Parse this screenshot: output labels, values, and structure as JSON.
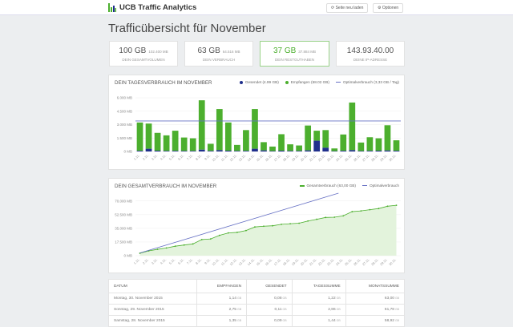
{
  "header": {
    "app_title": "UCB Traffic Analytics",
    "reload_label": "Seite neu laden",
    "options_label": "Optionen",
    "reload_icon": "refresh-icon",
    "options_icon": "gear-icon"
  },
  "page_title": "Trafficübersicht für November",
  "cards": [
    {
      "value": "100 GB",
      "sub": "102.400 MB",
      "label": "Dein Gesamtvolumen"
    },
    {
      "value": "63 GB",
      "sub": "64.516 MB",
      "label": "Dein Verbrauch"
    },
    {
      "value": "37 GB",
      "sub": "37.884 MB",
      "label": "Dein Restguthaben",
      "highlight": true
    },
    {
      "value": "143.93.40.00",
      "sub": "",
      "label": "Deine IP-Adresse"
    }
  ],
  "colors": {
    "sent": "#1f2f8c",
    "received": "#4caf2e",
    "optimal": "#6670c4",
    "highlight": "#4caf2e"
  },
  "chart_data": [
    {
      "type": "bar",
      "stacked": true,
      "title": "Dein Tagesverbrauch im November",
      "categories": [
        "1.11.",
        "2.11.",
        "3.11.",
        "4.11.",
        "5.11.",
        "6.11.",
        "7.11.",
        "8.11.",
        "9.11.",
        "10.11.",
        "11.11.",
        "12.11.",
        "13.11.",
        "14.11.",
        "15.11.",
        "16.11.",
        "17.11.",
        "18.11.",
        "19.11.",
        "20.11.",
        "21.11.",
        "22.11.",
        "23.11.",
        "24.11.",
        "25.11.",
        "26.11.",
        "27.11.",
        "28.11.",
        "29.11.",
        "30.11."
      ],
      "series": [
        {
          "name": "Gesendet (4.99 GB)",
          "values": [
            80,
            300,
            90,
            60,
            70,
            60,
            60,
            200,
            60,
            150,
            90,
            60,
            70,
            300,
            120,
            50,
            90,
            60,
            60,
            120,
            1200,
            420,
            40,
            80,
            150,
            50,
            70,
            90,
            110,
            80
          ]
        },
        {
          "name": "Empfangen (58.02 GB)",
          "values": [
            3160,
            2820,
            1990,
            1740,
            2250,
            1500,
            1410,
            5520,
            800,
            4590,
            3150,
            670,
            2320,
            4440,
            920,
            500,
            1840,
            740,
            610,
            2780,
            1120,
            1970,
            300,
            1820,
            5320,
            950,
            1520,
            1380,
            2820,
            1170
          ]
        }
      ],
      "reference_line": {
        "name": "Optimalverbrauch (3,33 GB / Tag)",
        "value": 3410
      },
      "yticks": [
        "0 MB",
        "1.500 MB",
        "3.000 MB",
        "4.500 MB",
        "6.000 MB"
      ],
      "ytick_values": [
        0,
        1500,
        3000,
        4500,
        6000
      ],
      "ylim": [
        0,
        6000
      ],
      "legend": "top-right",
      "grid": true
    },
    {
      "type": "area",
      "title": "Dein Gesamtverbrauch im November",
      "categories": [
        "1.11.",
        "2.11.",
        "3.11.",
        "4.11.",
        "5.11.",
        "6.11.",
        "7.11.",
        "8.11.",
        "9.11.",
        "10.11.",
        "11.11.",
        "12.11.",
        "13.11.",
        "14.11.",
        "15.11.",
        "16.11.",
        "17.11.",
        "18.11.",
        "19.11.",
        "20.11.",
        "21.11.",
        "22.11.",
        "23.11.",
        "24.11.",
        "25.11.",
        "26.11.",
        "27.11.",
        "28.11.",
        "29.11.",
        "30.11."
      ],
      "series": [
        {
          "name": "Gesamtverbrauch (63,00 GB)",
          "values": [
            3130,
            6144,
            8153,
            9892,
            12133,
            13640,
            15060,
            20585,
            21416,
            25995,
            29125,
            29830,
            32139,
            36718,
            37723,
            38254,
            40118,
            40891,
            41538,
            44339,
            46581,
            48889,
            49218,
            51053,
            56337,
            57303,
            58839,
            60317,
            63273,
            64516
          ]
        },
        {
          "name": "Optimalverbrauch",
          "per_day": 3410
        }
      ],
      "yticks": [
        "0 MB",
        "17.500 MB",
        "35.000 MB",
        "52.500 MB",
        "70.000 MB"
      ],
      "ytick_values": [
        0,
        17500,
        35000,
        52500,
        70000
      ],
      "ylim": [
        0,
        80000
      ],
      "legend": "top-right",
      "grid": true
    }
  ],
  "table": {
    "headers": [
      "Datum",
      "Empfangen",
      "Gesendet",
      "Tagessumme",
      "Monatssumme"
    ],
    "unit": "GB",
    "rows": [
      [
        "Montag, 30. November 2015",
        "1,14",
        "0,08",
        "1,22",
        "63,00"
      ],
      [
        "Sonntag, 29. November 2015",
        "2,75",
        "0,11",
        "2,86",
        "61,78"
      ],
      [
        "Samstag, 28. November 2015",
        "1,35",
        "0,09",
        "1,44",
        "58,92"
      ]
    ]
  }
}
